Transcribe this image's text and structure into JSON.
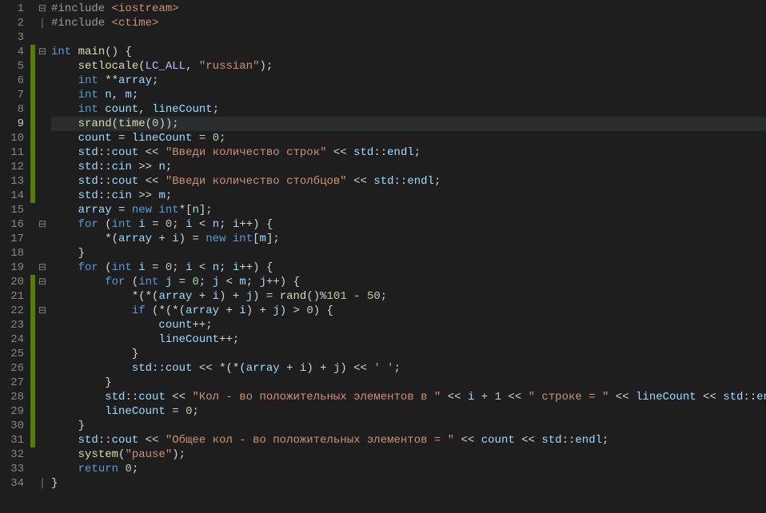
{
  "lines": [
    {
      "num": 1,
      "mark": false,
      "fold": "minus",
      "tokens": [
        [
          "inc",
          "#include "
        ],
        [
          "ang",
          "<iostream>"
        ]
      ]
    },
    {
      "num": 2,
      "mark": false,
      "fold": "bar",
      "tokens": [
        [
          "inc",
          "#include "
        ],
        [
          "ang",
          "<ctime>"
        ]
      ]
    },
    {
      "num": 3,
      "mark": false,
      "fold": "",
      "tokens": []
    },
    {
      "num": 4,
      "mark": true,
      "fold": "minus",
      "tokens": [
        [
          "t",
          "int"
        ],
        [
          "p",
          " "
        ],
        [
          "fn",
          "main"
        ],
        [
          "p",
          "() {"
        ]
      ]
    },
    {
      "num": 5,
      "mark": true,
      "fold": "",
      "indent": 1,
      "tokens": [
        [
          "fn",
          "setlocale"
        ],
        [
          "p",
          "("
        ],
        [
          "mac",
          "LC_ALL"
        ],
        [
          "p",
          ", "
        ],
        [
          "s",
          "\"russian\""
        ],
        [
          "p",
          ");"
        ]
      ]
    },
    {
      "num": 6,
      "mark": true,
      "fold": "",
      "indent": 1,
      "tokens": [
        [
          "t",
          "int"
        ],
        [
          "p",
          " **"
        ],
        [
          "c",
          "array"
        ],
        [
          "p",
          ";"
        ]
      ]
    },
    {
      "num": 7,
      "mark": true,
      "fold": "",
      "indent": 1,
      "tokens": [
        [
          "t",
          "int"
        ],
        [
          "p",
          " "
        ],
        [
          "c",
          "n"
        ],
        [
          "p",
          ", "
        ],
        [
          "c",
          "m"
        ],
        [
          "p",
          ";"
        ]
      ]
    },
    {
      "num": 8,
      "mark": true,
      "fold": "",
      "indent": 1,
      "tokens": [
        [
          "t",
          "int"
        ],
        [
          "p",
          " "
        ],
        [
          "c",
          "count"
        ],
        [
          "p",
          ", "
        ],
        [
          "c",
          "lineCount"
        ],
        [
          "p",
          ";"
        ]
      ]
    },
    {
      "num": 9,
      "mark": true,
      "fold": "",
      "indent": 1,
      "cur": true,
      "tokens": [
        [
          "fn",
          "srand"
        ],
        [
          "p",
          "("
        ],
        [
          "fn",
          "time"
        ],
        [
          "p",
          "("
        ],
        [
          "n",
          "0"
        ],
        [
          "p",
          "));"
        ]
      ]
    },
    {
      "num": 10,
      "mark": true,
      "fold": "",
      "indent": 1,
      "tokens": [
        [
          "c",
          "count"
        ],
        [
          "p",
          " = "
        ],
        [
          "c",
          "lineCount"
        ],
        [
          "p",
          " = "
        ],
        [
          "n",
          "0"
        ],
        [
          "p",
          ";"
        ]
      ]
    },
    {
      "num": 11,
      "mark": true,
      "fold": "",
      "indent": 1,
      "tokens": [
        [
          "c",
          "std"
        ],
        [
          "p",
          "::"
        ],
        [
          "c",
          "cout"
        ],
        [
          "p",
          " << "
        ],
        [
          "s",
          "\"Введи количество строк\""
        ],
        [
          "p",
          " << "
        ],
        [
          "c",
          "std"
        ],
        [
          "p",
          "::"
        ],
        [
          "c",
          "endl"
        ],
        [
          "p",
          ";"
        ]
      ]
    },
    {
      "num": 12,
      "mark": true,
      "fold": "",
      "indent": 1,
      "tokens": [
        [
          "c",
          "std"
        ],
        [
          "p",
          "::"
        ],
        [
          "c",
          "cin"
        ],
        [
          "p",
          " >> "
        ],
        [
          "c",
          "n"
        ],
        [
          "p",
          ";"
        ]
      ]
    },
    {
      "num": 13,
      "mark": true,
      "fold": "",
      "indent": 1,
      "tokens": [
        [
          "c",
          "std"
        ],
        [
          "p",
          "::"
        ],
        [
          "c",
          "cout"
        ],
        [
          "p",
          " << "
        ],
        [
          "s",
          "\"Введи количество столбцов\""
        ],
        [
          "p",
          " << "
        ],
        [
          "c",
          "std"
        ],
        [
          "p",
          "::"
        ],
        [
          "c",
          "endl"
        ],
        [
          "p",
          ";"
        ]
      ]
    },
    {
      "num": 14,
      "mark": true,
      "fold": "",
      "indent": 1,
      "tokens": [
        [
          "c",
          "std"
        ],
        [
          "p",
          "::"
        ],
        [
          "c",
          "cin"
        ],
        [
          "p",
          " >> "
        ],
        [
          "c",
          "m"
        ],
        [
          "p",
          ";"
        ]
      ]
    },
    {
      "num": 15,
      "mark": false,
      "fold": "",
      "indent": 1,
      "tokens": [
        [
          "c",
          "array"
        ],
        [
          "p",
          " = "
        ],
        [
          "k",
          "new"
        ],
        [
          "p",
          " "
        ],
        [
          "t",
          "int"
        ],
        [
          "p",
          "*["
        ],
        [
          "c",
          "n"
        ],
        [
          "p",
          "];"
        ]
      ]
    },
    {
      "num": 16,
      "mark": false,
      "fold": "minus",
      "indent": 1,
      "tokens": [
        [
          "k",
          "for"
        ],
        [
          "p",
          " ("
        ],
        [
          "t",
          "int"
        ],
        [
          "p",
          " "
        ],
        [
          "c",
          "i"
        ],
        [
          "p",
          " = "
        ],
        [
          "n",
          "0"
        ],
        [
          "p",
          "; "
        ],
        [
          "c",
          "i"
        ],
        [
          "p",
          " < "
        ],
        [
          "c",
          "n"
        ],
        [
          "p",
          "; "
        ],
        [
          "c",
          "i"
        ],
        [
          "p",
          "++) {"
        ]
      ]
    },
    {
      "num": 17,
      "mark": false,
      "fold": "",
      "indent": 2,
      "tokens": [
        [
          "p",
          "*("
        ],
        [
          "c",
          "array"
        ],
        [
          "p",
          " + "
        ],
        [
          "c",
          "i"
        ],
        [
          "p",
          ") = "
        ],
        [
          "k",
          "new"
        ],
        [
          "p",
          " "
        ],
        [
          "t",
          "int"
        ],
        [
          "p",
          "["
        ],
        [
          "c",
          "m"
        ],
        [
          "p",
          "];"
        ]
      ]
    },
    {
      "num": 18,
      "mark": false,
      "fold": "",
      "indent": 1,
      "tokens": [
        [
          "p",
          "}"
        ]
      ]
    },
    {
      "num": 19,
      "mark": false,
      "fold": "minus",
      "indent": 1,
      "tokens": [
        [
          "k",
          "for"
        ],
        [
          "p",
          " ("
        ],
        [
          "t",
          "int"
        ],
        [
          "p",
          " "
        ],
        [
          "c",
          "i"
        ],
        [
          "p",
          " = "
        ],
        [
          "n",
          "0"
        ],
        [
          "p",
          "; "
        ],
        [
          "c",
          "i"
        ],
        [
          "p",
          " < "
        ],
        [
          "c",
          "n"
        ],
        [
          "p",
          "; "
        ],
        [
          "c",
          "i"
        ],
        [
          "p",
          "++) {"
        ]
      ]
    },
    {
      "num": 20,
      "mark": true,
      "fold": "minus",
      "indent": 2,
      "tokens": [
        [
          "k",
          "for"
        ],
        [
          "p",
          " ("
        ],
        [
          "t",
          "int"
        ],
        [
          "p",
          " "
        ],
        [
          "c",
          "j"
        ],
        [
          "p",
          " = "
        ],
        [
          "n",
          "0"
        ],
        [
          "p",
          "; "
        ],
        [
          "c",
          "j"
        ],
        [
          "p",
          " < "
        ],
        [
          "c",
          "m"
        ],
        [
          "p",
          "; "
        ],
        [
          "c",
          "j"
        ],
        [
          "p",
          "++) {"
        ]
      ]
    },
    {
      "num": 21,
      "mark": true,
      "fold": "",
      "indent": 3,
      "tokens": [
        [
          "p",
          "*(*("
        ],
        [
          "c",
          "array"
        ],
        [
          "p",
          " + "
        ],
        [
          "c",
          "i"
        ],
        [
          "p",
          ") + "
        ],
        [
          "c",
          "j"
        ],
        [
          "p",
          ") = "
        ],
        [
          "fn",
          "rand"
        ],
        [
          "p",
          "()%"
        ],
        [
          "n",
          "101"
        ],
        [
          "p",
          " - "
        ],
        [
          "n",
          "50"
        ],
        [
          "p",
          ";"
        ]
      ]
    },
    {
      "num": 22,
      "mark": true,
      "fold": "minus",
      "indent": 3,
      "tokens": [
        [
          "k",
          "if"
        ],
        [
          "p",
          " (*(*("
        ],
        [
          "c",
          "array"
        ],
        [
          "p",
          " + "
        ],
        [
          "c",
          "i"
        ],
        [
          "p",
          ") + "
        ],
        [
          "c",
          "j"
        ],
        [
          "p",
          ") > "
        ],
        [
          "n",
          "0"
        ],
        [
          "p",
          ") {"
        ]
      ]
    },
    {
      "num": 23,
      "mark": true,
      "fold": "",
      "indent": 4,
      "tokens": [
        [
          "c",
          "count"
        ],
        [
          "p",
          "++;"
        ]
      ]
    },
    {
      "num": 24,
      "mark": true,
      "fold": "",
      "indent": 4,
      "tokens": [
        [
          "c",
          "lineCount"
        ],
        [
          "p",
          "++;"
        ]
      ]
    },
    {
      "num": 25,
      "mark": true,
      "fold": "",
      "indent": 3,
      "tokens": [
        [
          "p",
          "}"
        ]
      ]
    },
    {
      "num": 26,
      "mark": true,
      "fold": "",
      "indent": 3,
      "tokens": [
        [
          "c",
          "std"
        ],
        [
          "p",
          "::"
        ],
        [
          "c",
          "cout"
        ],
        [
          "p",
          " << *(*("
        ],
        [
          "c",
          "array"
        ],
        [
          "p",
          " + "
        ],
        [
          "c",
          "i"
        ],
        [
          "p",
          ") + "
        ],
        [
          "c",
          "j"
        ],
        [
          "p",
          ") << "
        ],
        [
          "ch",
          "' '"
        ],
        [
          "p",
          ";"
        ]
      ]
    },
    {
      "num": 27,
      "mark": true,
      "fold": "",
      "indent": 2,
      "tokens": [
        [
          "p",
          "}"
        ]
      ]
    },
    {
      "num": 28,
      "mark": true,
      "fold": "",
      "indent": 2,
      "tokens": [
        [
          "c",
          "std"
        ],
        [
          "p",
          "::"
        ],
        [
          "c",
          "cout"
        ],
        [
          "p",
          " << "
        ],
        [
          "s",
          "\"Кол - во положительных элементов в \""
        ],
        [
          "p",
          " << "
        ],
        [
          "c",
          "i"
        ],
        [
          "p",
          " + "
        ],
        [
          "n",
          "1"
        ],
        [
          "p",
          " << "
        ],
        [
          "s",
          "\" строке = \""
        ],
        [
          "p",
          " << "
        ],
        [
          "c",
          "lineCount"
        ],
        [
          "p",
          " << "
        ],
        [
          "c",
          "std"
        ],
        [
          "p",
          "::"
        ],
        [
          "c",
          "endl"
        ],
        [
          "p",
          ";"
        ]
      ]
    },
    {
      "num": 29,
      "mark": true,
      "fold": "",
      "indent": 2,
      "tokens": [
        [
          "c",
          "lineCount"
        ],
        [
          "p",
          " = "
        ],
        [
          "n",
          "0"
        ],
        [
          "p",
          ";"
        ]
      ]
    },
    {
      "num": 30,
      "mark": true,
      "fold": "",
      "indent": 1,
      "tokens": [
        [
          "p",
          "}"
        ]
      ]
    },
    {
      "num": 31,
      "mark": true,
      "fold": "",
      "indent": 1,
      "tokens": [
        [
          "c",
          "std"
        ],
        [
          "p",
          "::"
        ],
        [
          "c",
          "cout"
        ],
        [
          "p",
          " << "
        ],
        [
          "s",
          "\"Общее кол - во положительных элементов = \""
        ],
        [
          "p",
          " << "
        ],
        [
          "c",
          "count"
        ],
        [
          "p",
          " << "
        ],
        [
          "c",
          "std"
        ],
        [
          "p",
          "::"
        ],
        [
          "c",
          "endl"
        ],
        [
          "p",
          ";"
        ]
      ]
    },
    {
      "num": 32,
      "mark": false,
      "fold": "",
      "indent": 1,
      "tokens": [
        [
          "fn",
          "system"
        ],
        [
          "p",
          "("
        ],
        [
          "s",
          "\"pause\""
        ],
        [
          "p",
          ");"
        ]
      ]
    },
    {
      "num": 33,
      "mark": false,
      "fold": "",
      "indent": 1,
      "tokens": [
        [
          "k",
          "return"
        ],
        [
          "p",
          " "
        ],
        [
          "n",
          "0"
        ],
        [
          "p",
          ";"
        ]
      ]
    },
    {
      "num": 34,
      "mark": false,
      "fold": "bar",
      "tokens": [
        [
          "p",
          "}"
        ]
      ]
    }
  ],
  "indentUnit": "    "
}
